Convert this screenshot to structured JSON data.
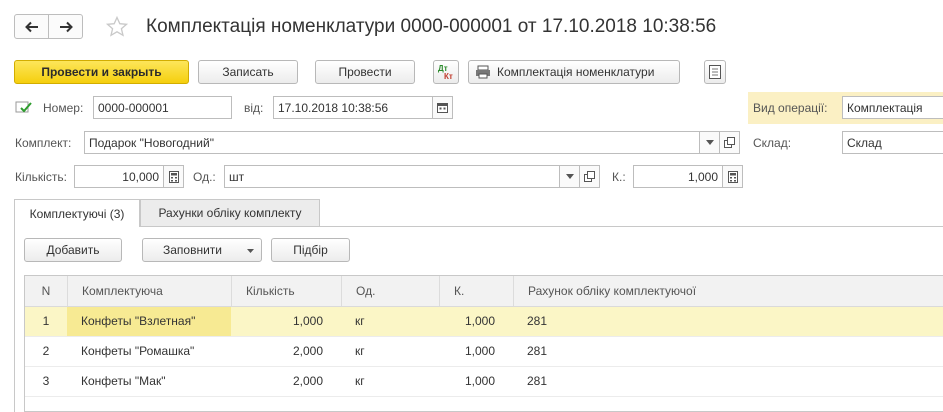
{
  "window": {
    "title": "Комплектація номенклатури 0000-000001 от 17.10.2018 10:38:56"
  },
  "toolbar": {
    "post_close_label": "Провести и закрыть",
    "save_label": "Записать",
    "post_label": "Провести",
    "dtkt_icon": "dt-kt-icon",
    "print_label": "Комплектація номенклатури",
    "report_icon": "report-icon"
  },
  "header": {
    "number_label": "Номер:",
    "number_value": "0000-000001",
    "date_label": "від:",
    "date_value": "17.10.2018 10:38:56",
    "operation_label": "Вид операції:",
    "operation_value": "Комплектація",
    "kit_label": "Комплект:",
    "kit_value": "Подарок \"Новогодний\"",
    "warehouse_label": "Склад:",
    "warehouse_value": "Склад",
    "qty_label": "Кількість:",
    "qty_value": "10,000",
    "unit_label": "Од.:",
    "unit_value": "шт",
    "k_label": "К.:",
    "k_value": "1,000"
  },
  "tabs": [
    {
      "label": "Комплектуючі (3)",
      "active": true
    },
    {
      "label": "Рахунки обліку комплекту",
      "active": false
    }
  ],
  "table_toolbar": {
    "add_label": "Добавить",
    "fill_label": "Заповнити",
    "pick_label": "Підбір"
  },
  "table": {
    "columns": [
      "N",
      "Комплектуюча",
      "Кількість",
      "Од.",
      "К.",
      "Рахунок обліку комплектуючої"
    ],
    "rows": [
      {
        "n": "1",
        "item": "Конфеты \"Взлетная\"",
        "qty": "1,000",
        "unit": "кг",
        "k": "1,000",
        "account": "281",
        "selected": true
      },
      {
        "n": "2",
        "item": "Конфеты \"Ромашка\"",
        "qty": "2,000",
        "unit": "кг",
        "k": "1,000",
        "account": "281",
        "selected": false
      },
      {
        "n": "3",
        "item": "Конфеты \"Мак\"",
        "qty": "2,000",
        "unit": "кг",
        "k": "1,000",
        "account": "281",
        "selected": false
      }
    ]
  },
  "colors": {
    "primary_button": "#f5cf0e",
    "selected_row": "#fbf6c6",
    "operation_highlight": "#fbf0c4"
  }
}
